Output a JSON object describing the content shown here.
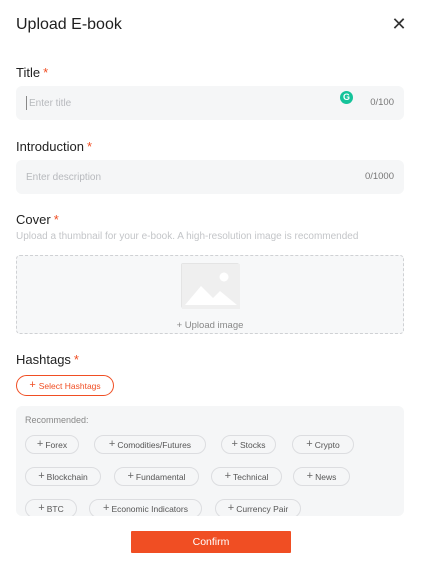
{
  "modal": {
    "title": "Upload E-book",
    "close_label": "✕"
  },
  "title_field": {
    "label": "Title",
    "required_mark": "*",
    "placeholder": "Enter title",
    "value": "",
    "counter": "0/100"
  },
  "intro_field": {
    "label": "Introduction",
    "required_mark": "*",
    "placeholder": "Enter description",
    "value": "",
    "counter": "0/1000"
  },
  "cover": {
    "label": "Cover",
    "required_mark": "*",
    "hint": "Upload a thumbnail for your e-book. A high-resolution image is recommended",
    "upload_label": "+ Upload image"
  },
  "hashtags": {
    "label": "Hashtags",
    "required_mark": "*",
    "select_plus": "+",
    "select_label": "Select Hashtags",
    "recommended_title": "Recommended:",
    "chip_plus": "+",
    "chips": [
      "Forex",
      "Comodities/Futures",
      "Stocks",
      "Crypto",
      "Blockchain",
      "Fundamental",
      "Technical",
      "News",
      "BTC",
      "Economic Indicators",
      "Currency Pair"
    ]
  },
  "confirm_label": "Confirm",
  "colors": {
    "accent": "#f04e23",
    "field_bg": "#f5f6f7",
    "grammarly": "#15c39a"
  },
  "icons": {
    "close": "close-icon",
    "grammarly": "grammarly-icon",
    "image": "image-placeholder-icon",
    "plus": "plus-icon"
  }
}
